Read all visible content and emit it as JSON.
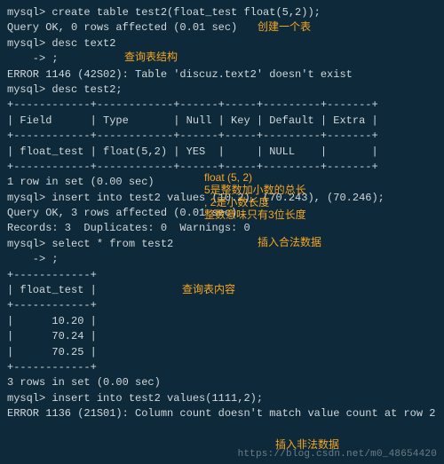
{
  "lines": {
    "l0": "mysql> create table test2(float_test float(5,2));",
    "l1": "Query OK, 0 rows affected (0.01 sec)",
    "l2": "",
    "l3": "mysql> desc text2",
    "l4": "    -> ;",
    "l5": "ERROR 1146 (42S02): Table 'discuz.text2' doesn't exist",
    "l6": "mysql> desc test2;",
    "l7": "+------------+------------+------+-----+---------+-------+",
    "l8": "| Field      | Type       | Null | Key | Default | Extra |",
    "l9": "+------------+------------+------+-----+---------+-------+",
    "l10": "| float_test | float(5,2) | YES  |     | NULL    |       |",
    "l11": "+------------+------------+------+-----+---------+-------+",
    "l12": "1 row in set (0.00 sec)",
    "l13": "",
    "l14": "mysql> insert into test2 values (10.2), (70.243), (70.246);",
    "l15": "Query OK, 3 rows affected (0.01 sec)",
    "l16": "Records: 3  Duplicates: 0  Warnings: 0",
    "l17": "",
    "l18": "mysql> select * from test2",
    "l19": "    -> ;",
    "l20": "+------------+",
    "l21": "| float_test |",
    "l22": "+------------+",
    "l23": "|      10.20 |",
    "l24": "|      70.24 |",
    "l25": "|      70.25 |",
    "l26": "+------------+",
    "l27": "3 rows in set (0.00 sec)",
    "l28": "",
    "l29": "mysql> insert into test2 values(1111,2);",
    "l30": "ERROR 1136 (21S01): Column count doesn't match value count at row 2"
  },
  "annotations": {
    "a0": "创建一个表",
    "a1": "查询表结构",
    "a2": "float (5, 2)",
    "a3": "5是整数加小数的总长",
    "a4": ", 2是小数长度",
    "a5": "整数意味只有3位长度",
    "a6": "插入合法数据",
    "a7": "查询表内容",
    "a8": "插入非法数据"
  },
  "watermark": "https://blog.csdn.net/m0_48654420"
}
